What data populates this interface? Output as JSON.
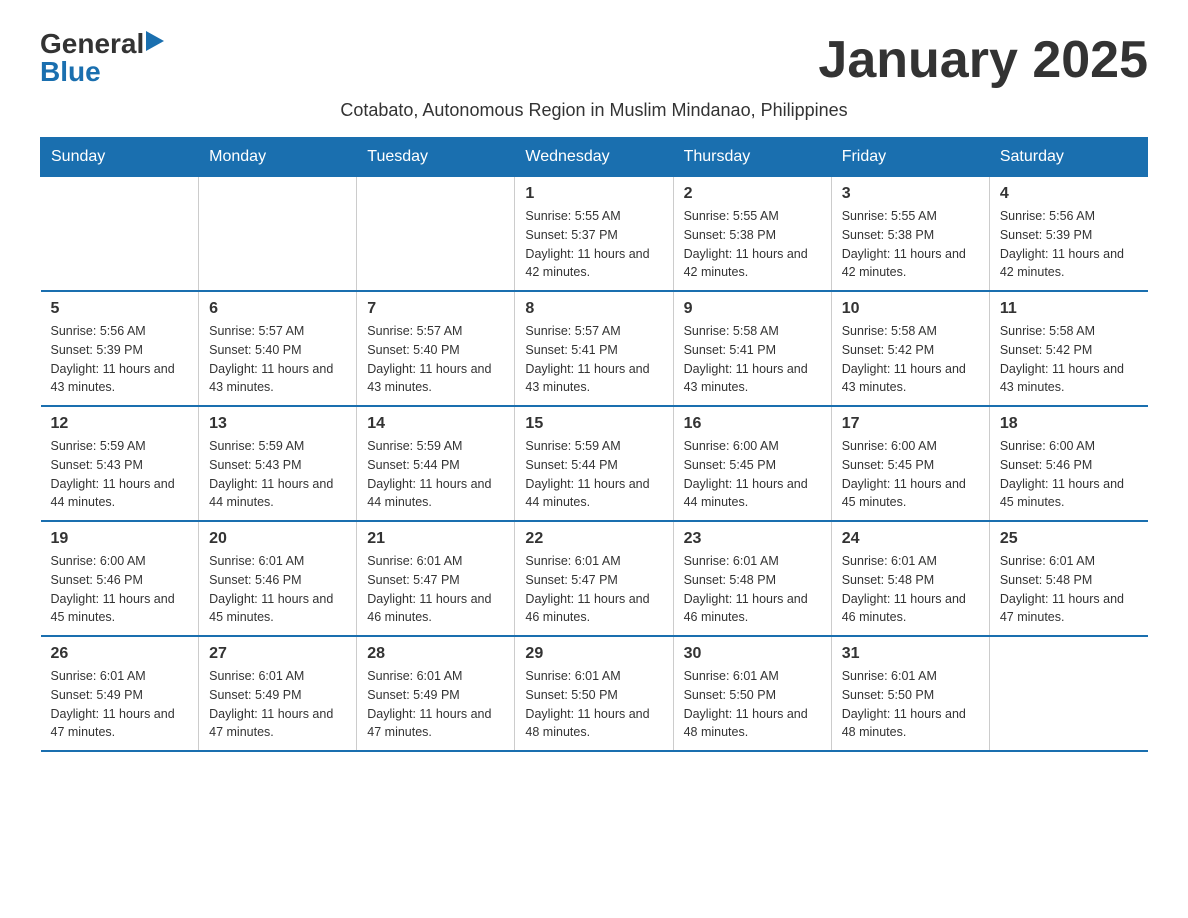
{
  "header": {
    "logo_general": "General",
    "logo_blue": "Blue",
    "month_title": "January 2025",
    "subtitle": "Cotabato, Autonomous Region in Muslim Mindanao, Philippines"
  },
  "days_of_week": [
    "Sunday",
    "Monday",
    "Tuesday",
    "Wednesday",
    "Thursday",
    "Friday",
    "Saturday"
  ],
  "weeks": [
    [
      {
        "day": "",
        "info": ""
      },
      {
        "day": "",
        "info": ""
      },
      {
        "day": "",
        "info": ""
      },
      {
        "day": "1",
        "info": "Sunrise: 5:55 AM\nSunset: 5:37 PM\nDaylight: 11 hours and 42 minutes."
      },
      {
        "day": "2",
        "info": "Sunrise: 5:55 AM\nSunset: 5:38 PM\nDaylight: 11 hours and 42 minutes."
      },
      {
        "day": "3",
        "info": "Sunrise: 5:55 AM\nSunset: 5:38 PM\nDaylight: 11 hours and 42 minutes."
      },
      {
        "day": "4",
        "info": "Sunrise: 5:56 AM\nSunset: 5:39 PM\nDaylight: 11 hours and 42 minutes."
      }
    ],
    [
      {
        "day": "5",
        "info": "Sunrise: 5:56 AM\nSunset: 5:39 PM\nDaylight: 11 hours and 43 minutes."
      },
      {
        "day": "6",
        "info": "Sunrise: 5:57 AM\nSunset: 5:40 PM\nDaylight: 11 hours and 43 minutes."
      },
      {
        "day": "7",
        "info": "Sunrise: 5:57 AM\nSunset: 5:40 PM\nDaylight: 11 hours and 43 minutes."
      },
      {
        "day": "8",
        "info": "Sunrise: 5:57 AM\nSunset: 5:41 PM\nDaylight: 11 hours and 43 minutes."
      },
      {
        "day": "9",
        "info": "Sunrise: 5:58 AM\nSunset: 5:41 PM\nDaylight: 11 hours and 43 minutes."
      },
      {
        "day": "10",
        "info": "Sunrise: 5:58 AM\nSunset: 5:42 PM\nDaylight: 11 hours and 43 minutes."
      },
      {
        "day": "11",
        "info": "Sunrise: 5:58 AM\nSunset: 5:42 PM\nDaylight: 11 hours and 43 minutes."
      }
    ],
    [
      {
        "day": "12",
        "info": "Sunrise: 5:59 AM\nSunset: 5:43 PM\nDaylight: 11 hours and 44 minutes."
      },
      {
        "day": "13",
        "info": "Sunrise: 5:59 AM\nSunset: 5:43 PM\nDaylight: 11 hours and 44 minutes."
      },
      {
        "day": "14",
        "info": "Sunrise: 5:59 AM\nSunset: 5:44 PM\nDaylight: 11 hours and 44 minutes."
      },
      {
        "day": "15",
        "info": "Sunrise: 5:59 AM\nSunset: 5:44 PM\nDaylight: 11 hours and 44 minutes."
      },
      {
        "day": "16",
        "info": "Sunrise: 6:00 AM\nSunset: 5:45 PM\nDaylight: 11 hours and 44 minutes."
      },
      {
        "day": "17",
        "info": "Sunrise: 6:00 AM\nSunset: 5:45 PM\nDaylight: 11 hours and 45 minutes."
      },
      {
        "day": "18",
        "info": "Sunrise: 6:00 AM\nSunset: 5:46 PM\nDaylight: 11 hours and 45 minutes."
      }
    ],
    [
      {
        "day": "19",
        "info": "Sunrise: 6:00 AM\nSunset: 5:46 PM\nDaylight: 11 hours and 45 minutes."
      },
      {
        "day": "20",
        "info": "Sunrise: 6:01 AM\nSunset: 5:46 PM\nDaylight: 11 hours and 45 minutes."
      },
      {
        "day": "21",
        "info": "Sunrise: 6:01 AM\nSunset: 5:47 PM\nDaylight: 11 hours and 46 minutes."
      },
      {
        "day": "22",
        "info": "Sunrise: 6:01 AM\nSunset: 5:47 PM\nDaylight: 11 hours and 46 minutes."
      },
      {
        "day": "23",
        "info": "Sunrise: 6:01 AM\nSunset: 5:48 PM\nDaylight: 11 hours and 46 minutes."
      },
      {
        "day": "24",
        "info": "Sunrise: 6:01 AM\nSunset: 5:48 PM\nDaylight: 11 hours and 46 minutes."
      },
      {
        "day": "25",
        "info": "Sunrise: 6:01 AM\nSunset: 5:48 PM\nDaylight: 11 hours and 47 minutes."
      }
    ],
    [
      {
        "day": "26",
        "info": "Sunrise: 6:01 AM\nSunset: 5:49 PM\nDaylight: 11 hours and 47 minutes."
      },
      {
        "day": "27",
        "info": "Sunrise: 6:01 AM\nSunset: 5:49 PM\nDaylight: 11 hours and 47 minutes."
      },
      {
        "day": "28",
        "info": "Sunrise: 6:01 AM\nSunset: 5:49 PM\nDaylight: 11 hours and 47 minutes."
      },
      {
        "day": "29",
        "info": "Sunrise: 6:01 AM\nSunset: 5:50 PM\nDaylight: 11 hours and 48 minutes."
      },
      {
        "day": "30",
        "info": "Sunrise: 6:01 AM\nSunset: 5:50 PM\nDaylight: 11 hours and 48 minutes."
      },
      {
        "day": "31",
        "info": "Sunrise: 6:01 AM\nSunset: 5:50 PM\nDaylight: 11 hours and 48 minutes."
      },
      {
        "day": "",
        "info": ""
      }
    ]
  ]
}
